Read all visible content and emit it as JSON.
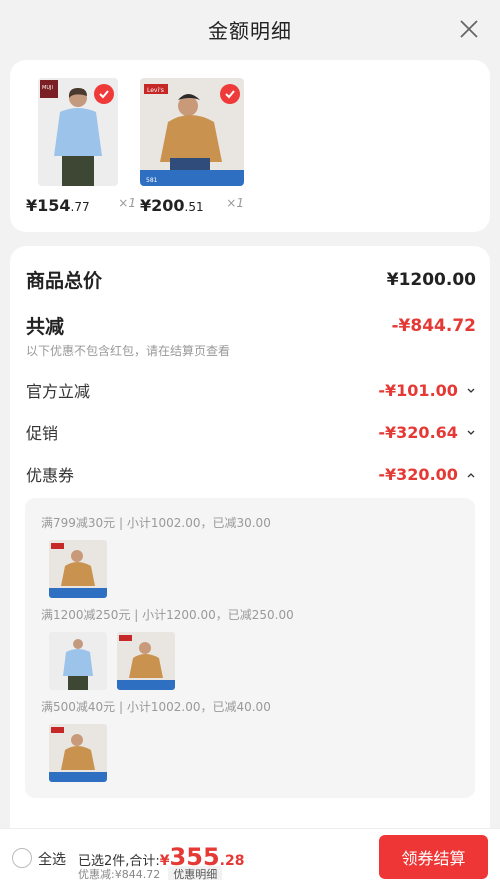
{
  "header": {
    "title": "金额明细"
  },
  "products": [
    {
      "brand": "MUJI",
      "price_int": "¥154",
      "price_dec": ".77",
      "qty": "×1"
    },
    {
      "brand": "Levi's",
      "price_int": "¥200",
      "price_dec": ".51",
      "qty": "×1"
    }
  ],
  "summary": {
    "total_label": "商品总价",
    "total_value": "¥1200.00",
    "discount_label": "共减",
    "discount_value": "-¥844.72",
    "discount_note": "以下优惠不包含红包，请在结算页查看",
    "official_label": "官方立减",
    "official_value": "-¥101.00",
    "promo_label": "促销",
    "promo_value": "-¥320.64",
    "coupon_label": "优惠券",
    "coupon_value": "-¥320.00"
  },
  "coupons": [
    {
      "text": "满799减30元 | 小计1002.00，已减30.00"
    },
    {
      "text": "满1200减250元 | 小计1200.00，已减250.00"
    },
    {
      "text": "满500减40元 | 小计1002.00，已减40.00"
    }
  ],
  "bottom": {
    "select_all": "全选",
    "selected_text": "已选2件,合计:",
    "total_cur": "¥",
    "total_int": "355",
    "total_dec": ".28",
    "discount_text": "优惠减:¥844.72",
    "detail_link": "优惠明细",
    "checkout": "领券结算"
  },
  "colors": {
    "accent": "#e53935",
    "button": "#ef3636"
  }
}
